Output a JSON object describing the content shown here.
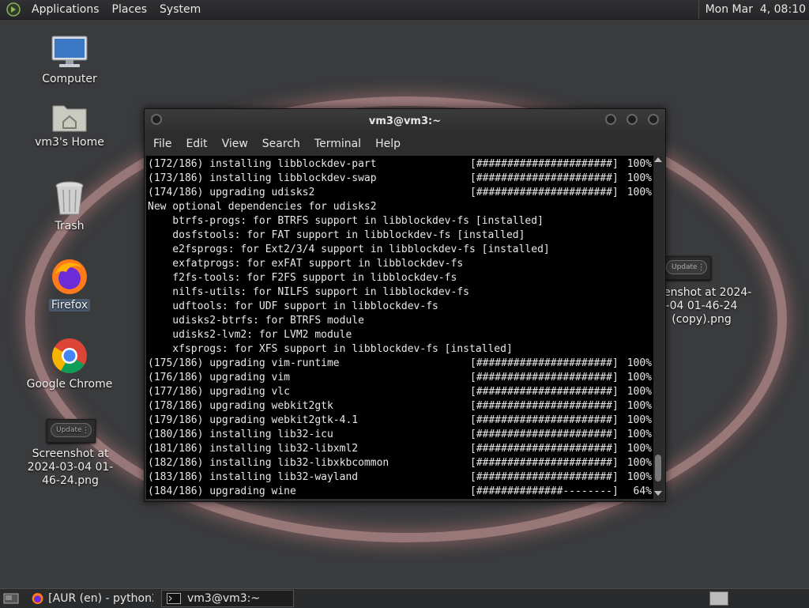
{
  "top_panel": {
    "menus": [
      "Applications",
      "Places",
      "System"
    ],
    "clock": "Mon Mar  4, 08:10"
  },
  "desktop": {
    "icons": [
      {
        "label": "Computer",
        "icon": "computer-icon"
      },
      {
        "label": "vm3's Home",
        "icon": "home-folder-icon"
      },
      {
        "label": "Trash",
        "icon": "trash-icon"
      },
      {
        "label": "Firefox",
        "icon": "firefox-icon"
      },
      {
        "label": "Google Chrome",
        "icon": "chrome-icon"
      },
      {
        "label": "Screenshot at 2024-03-04 01-46-24.png",
        "icon": "screenshot-thumbnail"
      }
    ],
    "right_file_label": "enshot at 2024-\n-04 01-46-24\n(copy).png",
    "update_label": "Update"
  },
  "terminal": {
    "title": "vm3@vm3:~",
    "menus": [
      "File",
      "Edit",
      "View",
      "Search",
      "Terminal",
      "Help"
    ],
    "lines": [
      {
        "msg": "(172/186) installing libblockdev-part",
        "bar": "[######################]",
        "pct": "100%"
      },
      {
        "msg": "(173/186) installing libblockdev-swap",
        "bar": "[######################]",
        "pct": "100%"
      },
      {
        "msg": "(174/186) upgrading udisks2",
        "bar": "[######################]",
        "pct": "100%"
      },
      {
        "msg": "New optional dependencies for udisks2"
      },
      {
        "msg": "    btrfs-progs: for BTRFS support in libblockdev-fs [installed]"
      },
      {
        "msg": "    dosfstools: for FAT support in libblockdev-fs [installed]"
      },
      {
        "msg": "    e2fsprogs: for Ext2/3/4 support in libblockdev-fs [installed]"
      },
      {
        "msg": "    exfatprogs: for exFAT support in libblockdev-fs"
      },
      {
        "msg": "    f2fs-tools: for F2FS support in libblockdev-fs"
      },
      {
        "msg": "    nilfs-utils: for NILFS support in libblockdev-fs"
      },
      {
        "msg": "    udftools: for UDF support in libblockdev-fs"
      },
      {
        "msg": "    udisks2-btrfs: for BTRFS module"
      },
      {
        "msg": "    udisks2-lvm2: for LVM2 module"
      },
      {
        "msg": "    xfsprogs: for XFS support in libblockdev-fs [installed]"
      },
      {
        "msg": "(175/186) upgrading vim-runtime",
        "bar": "[######################]",
        "pct": "100%"
      },
      {
        "msg": "(176/186) upgrading vim",
        "bar": "[######################]",
        "pct": "100%"
      },
      {
        "msg": "(177/186) upgrading vlc",
        "bar": "[######################]",
        "pct": "100%"
      },
      {
        "msg": "(178/186) upgrading webkit2gtk",
        "bar": "[######################]",
        "pct": "100%"
      },
      {
        "msg": "(179/186) upgrading webkit2gtk-4.1",
        "bar": "[######################]",
        "pct": "100%"
      },
      {
        "msg": "(180/186) installing lib32-icu",
        "bar": "[######################]",
        "pct": "100%"
      },
      {
        "msg": "(181/186) installing lib32-libxml2",
        "bar": "[######################]",
        "pct": "100%"
      },
      {
        "msg": "(182/186) installing lib32-libxkbcommon",
        "bar": "[######################]",
        "pct": "100%"
      },
      {
        "msg": "(183/186) installing lib32-wayland",
        "bar": "[######################]",
        "pct": "100%"
      },
      {
        "msg": "(184/186) upgrading wine",
        "bar": "[##############--------]",
        "pct": "64%"
      }
    ]
  },
  "taskbar": {
    "tasks": [
      {
        "label": "[AUR (en) - python2 ...",
        "icon": "firefox-icon"
      },
      {
        "label": "vm3@vm3:~",
        "icon": "terminal-icon"
      }
    ]
  }
}
